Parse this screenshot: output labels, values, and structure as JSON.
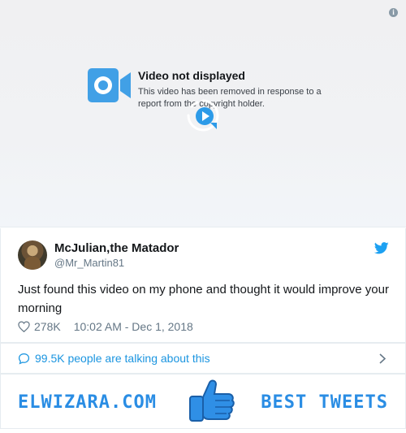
{
  "video": {
    "title": "Video not displayed",
    "description": "This video has been removed in response to a report from the copyright holder."
  },
  "tweet": {
    "author_name": "McJulian,the Matador",
    "author_handle": "@Mr_Martin81",
    "text": "Just found this video on my phone and thought it would improve your morning",
    "likes": "278K",
    "timestamp": "10:02 AM - Dec 1, 2018"
  },
  "conversation": {
    "label": "99.5K people are talking about this"
  },
  "banner": {
    "left_text": "ELWIZARA.COM",
    "right_text": "BEST TWEETS"
  },
  "icons": {
    "info": "info-icon",
    "camera": "video-camera-icon",
    "loader": "play-loader-icon",
    "twitter": "twitter-bird-icon",
    "heart": "heart-icon",
    "bubble": "speech-bubble-icon",
    "chevron": "chevron-right-icon",
    "thumb": "thumbs-up-icon"
  },
  "colors": {
    "twitter_blue": "#1da1f2",
    "link_blue": "#1b95e0",
    "banner_blue": "#2a8de4",
    "muted": "#657786"
  }
}
